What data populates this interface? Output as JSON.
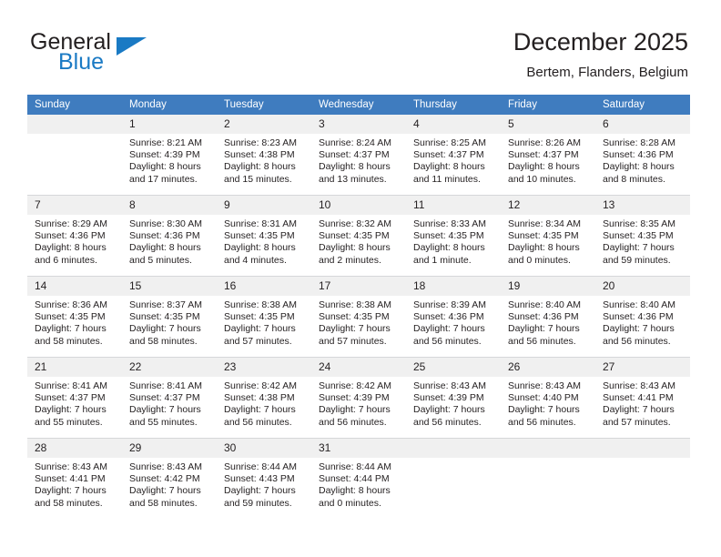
{
  "brand": {
    "name_top": "General",
    "name_bottom": "Blue",
    "triangle_color": "#1a7ac4",
    "text_color": "#231f20"
  },
  "header": {
    "title": "December 2025",
    "subtitle": "Bertem, Flanders, Belgium",
    "accent_color": "#3f7cbf"
  },
  "calendar": {
    "weekday_headers": [
      "Sunday",
      "Monday",
      "Tuesday",
      "Wednesday",
      "Thursday",
      "Friday",
      "Saturday"
    ],
    "labels": {
      "sunrise": "Sunrise:",
      "sunset": "Sunset:",
      "daylight": "Daylight:"
    },
    "weeks": [
      [
        {
          "day": "",
          "sunrise": "",
          "sunset": "",
          "daylight_line1": "",
          "daylight_line2": ""
        },
        {
          "day": "1",
          "sunrise": "Sunrise: 8:21 AM",
          "sunset": "Sunset: 4:39 PM",
          "daylight_line1": "Daylight: 8 hours",
          "daylight_line2": "and 17 minutes."
        },
        {
          "day": "2",
          "sunrise": "Sunrise: 8:23 AM",
          "sunset": "Sunset: 4:38 PM",
          "daylight_line1": "Daylight: 8 hours",
          "daylight_line2": "and 15 minutes."
        },
        {
          "day": "3",
          "sunrise": "Sunrise: 8:24 AM",
          "sunset": "Sunset: 4:37 PM",
          "daylight_line1": "Daylight: 8 hours",
          "daylight_line2": "and 13 minutes."
        },
        {
          "day": "4",
          "sunrise": "Sunrise: 8:25 AM",
          "sunset": "Sunset: 4:37 PM",
          "daylight_line1": "Daylight: 8 hours",
          "daylight_line2": "and 11 minutes."
        },
        {
          "day": "5",
          "sunrise": "Sunrise: 8:26 AM",
          "sunset": "Sunset: 4:37 PM",
          "daylight_line1": "Daylight: 8 hours",
          "daylight_line2": "and 10 minutes."
        },
        {
          "day": "6",
          "sunrise": "Sunrise: 8:28 AM",
          "sunset": "Sunset: 4:36 PM",
          "daylight_line1": "Daylight: 8 hours",
          "daylight_line2": "and 8 minutes."
        }
      ],
      [
        {
          "day": "7",
          "sunrise": "Sunrise: 8:29 AM",
          "sunset": "Sunset: 4:36 PM",
          "daylight_line1": "Daylight: 8 hours",
          "daylight_line2": "and 6 minutes."
        },
        {
          "day": "8",
          "sunrise": "Sunrise: 8:30 AM",
          "sunset": "Sunset: 4:36 PM",
          "daylight_line1": "Daylight: 8 hours",
          "daylight_line2": "and 5 minutes."
        },
        {
          "day": "9",
          "sunrise": "Sunrise: 8:31 AM",
          "sunset": "Sunset: 4:35 PM",
          "daylight_line1": "Daylight: 8 hours",
          "daylight_line2": "and 4 minutes."
        },
        {
          "day": "10",
          "sunrise": "Sunrise: 8:32 AM",
          "sunset": "Sunset: 4:35 PM",
          "daylight_line1": "Daylight: 8 hours",
          "daylight_line2": "and 2 minutes."
        },
        {
          "day": "11",
          "sunrise": "Sunrise: 8:33 AM",
          "sunset": "Sunset: 4:35 PM",
          "daylight_line1": "Daylight: 8 hours",
          "daylight_line2": "and 1 minute."
        },
        {
          "day": "12",
          "sunrise": "Sunrise: 8:34 AM",
          "sunset": "Sunset: 4:35 PM",
          "daylight_line1": "Daylight: 8 hours",
          "daylight_line2": "and 0 minutes."
        },
        {
          "day": "13",
          "sunrise": "Sunrise: 8:35 AM",
          "sunset": "Sunset: 4:35 PM",
          "daylight_line1": "Daylight: 7 hours",
          "daylight_line2": "and 59 minutes."
        }
      ],
      [
        {
          "day": "14",
          "sunrise": "Sunrise: 8:36 AM",
          "sunset": "Sunset: 4:35 PM",
          "daylight_line1": "Daylight: 7 hours",
          "daylight_line2": "and 58 minutes."
        },
        {
          "day": "15",
          "sunrise": "Sunrise: 8:37 AM",
          "sunset": "Sunset: 4:35 PM",
          "daylight_line1": "Daylight: 7 hours",
          "daylight_line2": "and 58 minutes."
        },
        {
          "day": "16",
          "sunrise": "Sunrise: 8:38 AM",
          "sunset": "Sunset: 4:35 PM",
          "daylight_line1": "Daylight: 7 hours",
          "daylight_line2": "and 57 minutes."
        },
        {
          "day": "17",
          "sunrise": "Sunrise: 8:38 AM",
          "sunset": "Sunset: 4:35 PM",
          "daylight_line1": "Daylight: 7 hours",
          "daylight_line2": "and 57 minutes."
        },
        {
          "day": "18",
          "sunrise": "Sunrise: 8:39 AM",
          "sunset": "Sunset: 4:36 PM",
          "daylight_line1": "Daylight: 7 hours",
          "daylight_line2": "and 56 minutes."
        },
        {
          "day": "19",
          "sunrise": "Sunrise: 8:40 AM",
          "sunset": "Sunset: 4:36 PM",
          "daylight_line1": "Daylight: 7 hours",
          "daylight_line2": "and 56 minutes."
        },
        {
          "day": "20",
          "sunrise": "Sunrise: 8:40 AM",
          "sunset": "Sunset: 4:36 PM",
          "daylight_line1": "Daylight: 7 hours",
          "daylight_line2": "and 56 minutes."
        }
      ],
      [
        {
          "day": "21",
          "sunrise": "Sunrise: 8:41 AM",
          "sunset": "Sunset: 4:37 PM",
          "daylight_line1": "Daylight: 7 hours",
          "daylight_line2": "and 55 minutes."
        },
        {
          "day": "22",
          "sunrise": "Sunrise: 8:41 AM",
          "sunset": "Sunset: 4:37 PM",
          "daylight_line1": "Daylight: 7 hours",
          "daylight_line2": "and 55 minutes."
        },
        {
          "day": "23",
          "sunrise": "Sunrise: 8:42 AM",
          "sunset": "Sunset: 4:38 PM",
          "daylight_line1": "Daylight: 7 hours",
          "daylight_line2": "and 56 minutes."
        },
        {
          "day": "24",
          "sunrise": "Sunrise: 8:42 AM",
          "sunset": "Sunset: 4:39 PM",
          "daylight_line1": "Daylight: 7 hours",
          "daylight_line2": "and 56 minutes."
        },
        {
          "day": "25",
          "sunrise": "Sunrise: 8:43 AM",
          "sunset": "Sunset: 4:39 PM",
          "daylight_line1": "Daylight: 7 hours",
          "daylight_line2": "and 56 minutes."
        },
        {
          "day": "26",
          "sunrise": "Sunrise: 8:43 AM",
          "sunset": "Sunset: 4:40 PM",
          "daylight_line1": "Daylight: 7 hours",
          "daylight_line2": "and 56 minutes."
        },
        {
          "day": "27",
          "sunrise": "Sunrise: 8:43 AM",
          "sunset": "Sunset: 4:41 PM",
          "daylight_line1": "Daylight: 7 hours",
          "daylight_line2": "and 57 minutes."
        }
      ],
      [
        {
          "day": "28",
          "sunrise": "Sunrise: 8:43 AM",
          "sunset": "Sunset: 4:41 PM",
          "daylight_line1": "Daylight: 7 hours",
          "daylight_line2": "and 58 minutes."
        },
        {
          "day": "29",
          "sunrise": "Sunrise: 8:43 AM",
          "sunset": "Sunset: 4:42 PM",
          "daylight_line1": "Daylight: 7 hours",
          "daylight_line2": "and 58 minutes."
        },
        {
          "day": "30",
          "sunrise": "Sunrise: 8:44 AM",
          "sunset": "Sunset: 4:43 PM",
          "daylight_line1": "Daylight: 7 hours",
          "daylight_line2": "and 59 minutes."
        },
        {
          "day": "31",
          "sunrise": "Sunrise: 8:44 AM",
          "sunset": "Sunset: 4:44 PM",
          "daylight_line1": "Daylight: 8 hours",
          "daylight_line2": "and 0 minutes."
        },
        {
          "day": "",
          "sunrise": "",
          "sunset": "",
          "daylight_line1": "",
          "daylight_line2": ""
        },
        {
          "day": "",
          "sunrise": "",
          "sunset": "",
          "daylight_line1": "",
          "daylight_line2": ""
        },
        {
          "day": "",
          "sunrise": "",
          "sunset": "",
          "daylight_line1": "",
          "daylight_line2": ""
        }
      ]
    ]
  }
}
